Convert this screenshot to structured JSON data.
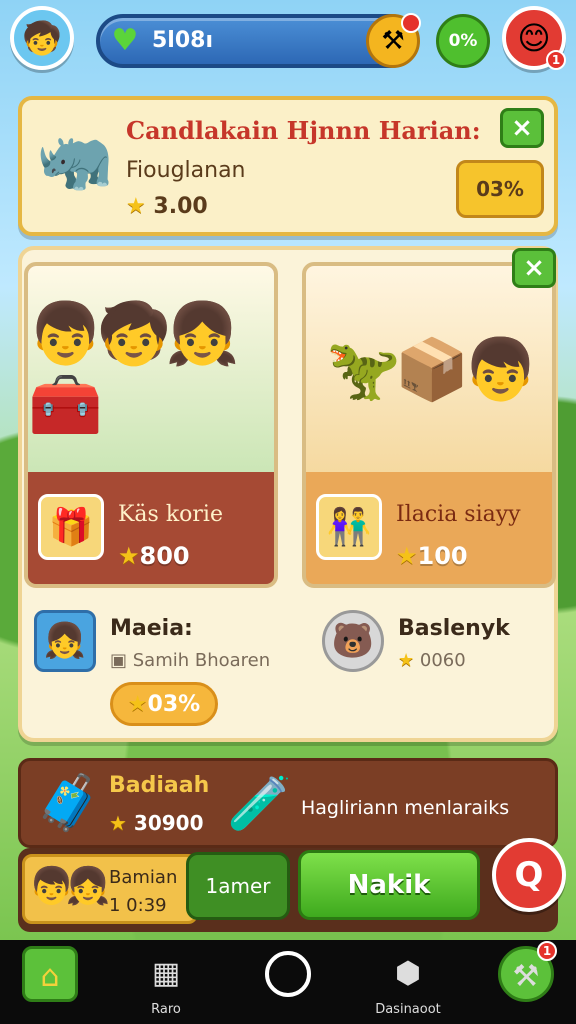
{
  "topbar": {
    "currency": "5l08ı",
    "percent_button": "0%",
    "profile_badge": "1",
    "icons": {
      "player": "player-avatar-icon",
      "gem": "heart-gem-icon",
      "tool": "hammer-wrench-icon",
      "profile": "profile-avatar-icon"
    }
  },
  "quest": {
    "title": "Candlakain Hjnnn Harian:",
    "subtitle": "Fiouglanan",
    "reward": "3.00",
    "button": "03%",
    "close": "×"
  },
  "panel": {
    "close": "×",
    "cards": [
      {
        "title": "Käs korie",
        "price": "800"
      },
      {
        "title": "Ilacia siayy",
        "price": "100"
      }
    ],
    "friends": [
      {
        "name": "Maeia:",
        "sub": "Samih Bhoaren",
        "pill": "03%"
      },
      {
        "name": "Baslenyk",
        "sub": "0060"
      }
    ]
  },
  "reward_bar": {
    "title": "Badiaah",
    "value": "30900",
    "text": "Hagliriann menlaraiks"
  },
  "actions": {
    "team_name": "Bamian",
    "team_time": "1 0:39",
    "secondary": "1amer",
    "primary": "Nakik",
    "search": "Q"
  },
  "nav": {
    "items": [
      {
        "label": "",
        "icon": "home-icon"
      },
      {
        "label": "Raro",
        "icon": "box-icon"
      },
      {
        "label": "",
        "icon": "ring-icon"
      },
      {
        "label": "Dasinaoot",
        "icon": "crate-icon"
      },
      {
        "label": "",
        "icon": "tools-icon",
        "badge": "1"
      }
    ]
  },
  "colors": {
    "accent_green": "#5cc13a",
    "accent_red": "#e23b33",
    "gold": "#f6c42c",
    "panel_cream": "#fbf3d9"
  }
}
